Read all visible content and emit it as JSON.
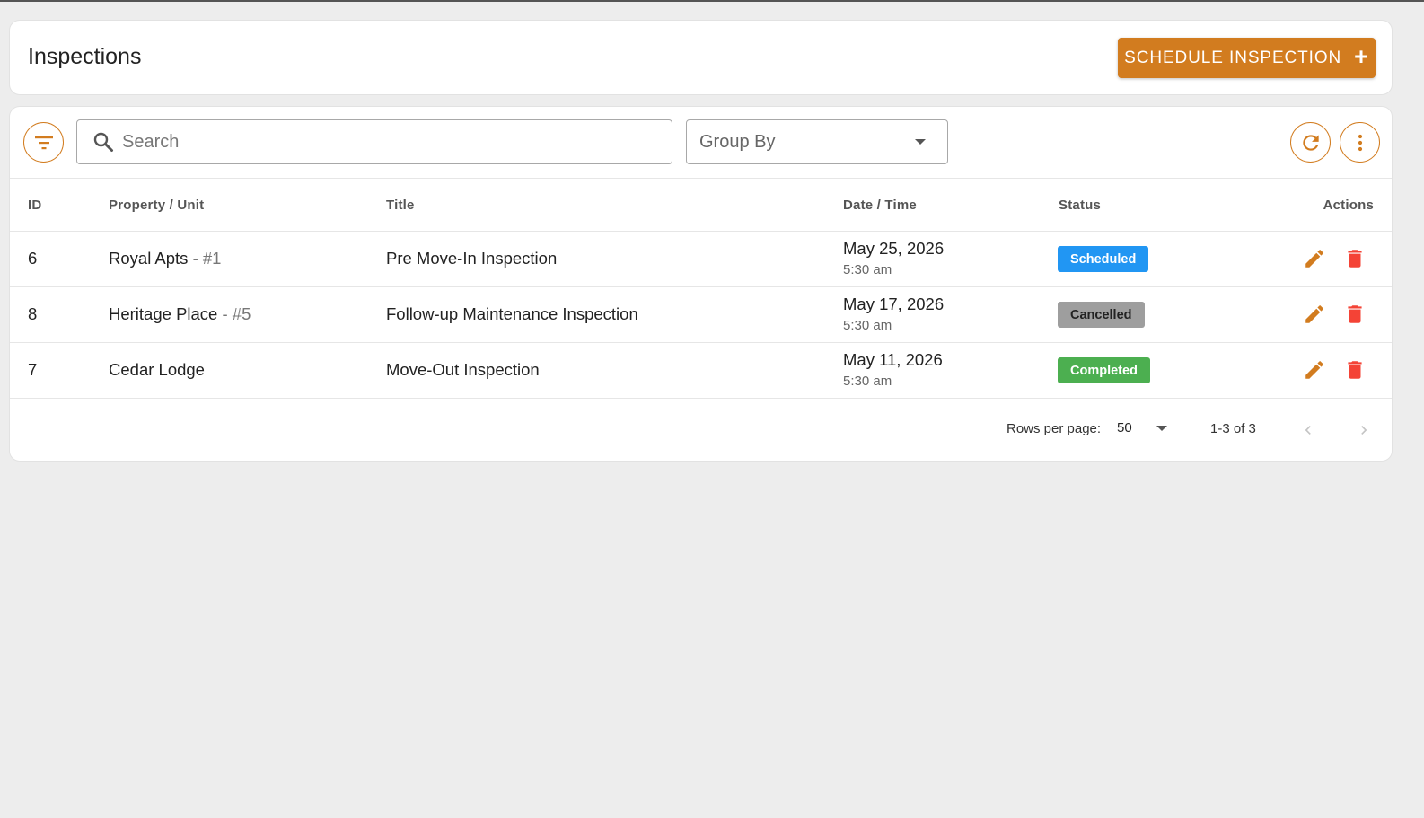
{
  "header": {
    "title": "Inspections",
    "schedule_button_label": "Schedule Inspection",
    "schedule_button_icon": "+"
  },
  "toolbar": {
    "search_placeholder": "Search",
    "group_by_label": "Group By"
  },
  "table": {
    "columns": {
      "id": "ID",
      "property_unit": "Property / Unit",
      "title": "Title",
      "date_time": "Date / Time",
      "status": "Status",
      "actions": "Actions"
    },
    "rows": [
      {
        "id": "6",
        "property": "Royal Apts",
        "unit": " - #1",
        "title": "Pre Move-In Inspection",
        "date": "May 25, 2026",
        "time": "5:30 am",
        "status": "Scheduled"
      },
      {
        "id": "8",
        "property": "Heritage Place",
        "unit": " - #5",
        "title": "Follow-up Maintenance Inspection",
        "date": "May 17, 2026",
        "time": "5:30 am",
        "status": "Cancelled"
      },
      {
        "id": "7",
        "property": "Cedar Lodge",
        "unit": "",
        "title": "Move-Out Inspection",
        "date": "May 11, 2026",
        "time": "5:30 am",
        "status": "Completed"
      }
    ]
  },
  "pagination": {
    "rows_per_page_label": "Rows per page:",
    "rows_per_page_value": "50",
    "range_label": "1-3 of 3"
  },
  "colors": {
    "accent": "#d27c1f",
    "status_scheduled": "#2196f3",
    "status_cancelled": "#9e9e9e",
    "status_completed": "#4caf50",
    "edit_icon": "#d27c1f",
    "delete_icon": "#f44336"
  },
  "icons": {
    "filter": "filter-icon",
    "search": "search-icon",
    "group_by_caret": "chevron-down-icon",
    "refresh": "refresh-icon",
    "more": "more-vertical-icon",
    "edit": "pencil-icon",
    "delete": "trash-icon",
    "prev": "chevron-left-icon",
    "next": "chevron-right-icon"
  }
}
